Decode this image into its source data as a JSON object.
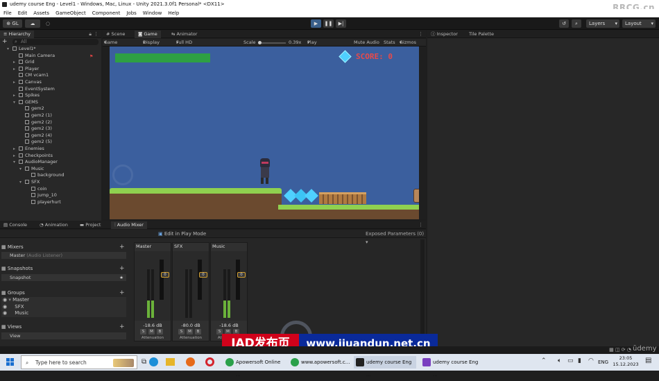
{
  "window": {
    "title": "udemy course Eng - Level1 - Windows, Mac, Linux - Unity 2021.3.0f1 Personal* <DX11>",
    "watermark_top": "RRCG.cn"
  },
  "menu": [
    "File",
    "Edit",
    "Assets",
    "GameObject",
    "Component",
    "Jobs",
    "Window",
    "Help"
  ],
  "toolbar": {
    "account": "GL",
    "layers": "Layers",
    "layout": "Layout"
  },
  "hierarchy": {
    "tab": "Hierarchy",
    "search_placeholder": "All",
    "items": [
      {
        "label": "Level1*",
        "depth": 0,
        "arrow": "▾",
        "icon": "unity-scene-icon"
      },
      {
        "label": "Main Camera",
        "depth": 1,
        "arrow": "",
        "icon": "gameobject-cube-icon"
      },
      {
        "label": "Grid",
        "depth": 1,
        "arrow": "▸",
        "icon": "gameobject-cube-icon"
      },
      {
        "label": "Player",
        "depth": 1,
        "arrow": "▸",
        "icon": "gameobject-cube-icon"
      },
      {
        "label": "CM vcam1",
        "depth": 1,
        "arrow": "",
        "icon": "gameobject-cube-icon"
      },
      {
        "label": "Canvas",
        "depth": 1,
        "arrow": "▸",
        "icon": "gameobject-cube-icon"
      },
      {
        "label": "EventSystem",
        "depth": 1,
        "arrow": "",
        "icon": "gameobject-cube-icon"
      },
      {
        "label": "Spikes",
        "depth": 1,
        "arrow": "▸",
        "icon": "gameobject-cube-icon"
      },
      {
        "label": "GEMS",
        "depth": 1,
        "arrow": "▾",
        "icon": "gameobject-cube-icon"
      },
      {
        "label": "gem2",
        "depth": 2,
        "arrow": "",
        "icon": "gameobject-cube-icon"
      },
      {
        "label": "gem2 (1)",
        "depth": 2,
        "arrow": "",
        "icon": "gameobject-cube-icon"
      },
      {
        "label": "gem2 (2)",
        "depth": 2,
        "arrow": "",
        "icon": "gameobject-cube-icon"
      },
      {
        "label": "gem2 (3)",
        "depth": 2,
        "arrow": "",
        "icon": "gameobject-cube-icon"
      },
      {
        "label": "gem2 (4)",
        "depth": 2,
        "arrow": "",
        "icon": "gameobject-cube-icon"
      },
      {
        "label": "gem2 (5)",
        "depth": 2,
        "arrow": "",
        "icon": "gameobject-cube-icon"
      },
      {
        "label": "Enemies",
        "depth": 1,
        "arrow": "▸",
        "icon": "gameobject-cube-icon"
      },
      {
        "label": "Checkpoints",
        "depth": 1,
        "arrow": "▸",
        "icon": "gameobject-cube-icon"
      },
      {
        "label": "AudioManager",
        "depth": 1,
        "arrow": "▾",
        "icon": "gameobject-cube-icon"
      },
      {
        "label": "Music",
        "depth": 2,
        "arrow": "▾",
        "icon": "gameobject-cube-icon"
      },
      {
        "label": "background",
        "depth": 3,
        "arrow": "",
        "icon": "gameobject-cube-icon"
      },
      {
        "label": "SFX",
        "depth": 2,
        "arrow": "▾",
        "icon": "gameobject-cube-icon"
      },
      {
        "label": "coin",
        "depth": 3,
        "arrow": "",
        "icon": "gameobject-cube-icon"
      },
      {
        "label": "jump_10",
        "depth": 3,
        "arrow": "",
        "icon": "gameobject-cube-icon"
      },
      {
        "label": "playerhurt",
        "depth": 3,
        "arrow": "",
        "icon": "gameobject-cube-icon"
      }
    ]
  },
  "center_tabs": [
    "Scene",
    "Game",
    "Animator"
  ],
  "game_bar": {
    "mode": "Game",
    "display": "Display 1",
    "resolution": "Full HD (1920x1080)",
    "scale_label": "Scale",
    "scale_value": "0.39x",
    "play_focused": "Play Focused",
    "mute_audio": "Mute Audio",
    "stats": "Stats",
    "gizmos": "Gizmos"
  },
  "game": {
    "score_text": "SCORE: 0",
    "health_fraction": 1.0
  },
  "right_tabs": [
    "Inspector",
    "Tile Palette"
  ],
  "bottom_tabs": [
    "Console",
    "Animation",
    "Project",
    "Audio Mixer"
  ],
  "mixer": {
    "edit_in_play_mode": "Edit in Play Mode",
    "exposed_parameters": "Exposed Parameters (0)",
    "mixers_head": "Mixers",
    "mixers_row": "Master",
    "mixers_row_dim": "(Audio Listener)",
    "snapshots_head": "Snapshots",
    "snapshots_row": "Snapshot",
    "groups_head": "Groups",
    "groups": [
      "Master",
      "SFX",
      "Music"
    ],
    "views_head": "Views",
    "views_row": "View",
    "strips": [
      {
        "name": "Master",
        "db": "-18.6 dB",
        "level": 0.35
      },
      {
        "name": "SFX",
        "db": "-80.0 dB",
        "level": 0.0
      },
      {
        "name": "Music",
        "db": "-18.6 dB",
        "level": 0.35
      }
    ],
    "strip_level_label": "0",
    "strip_buttons": [
      "S",
      "M",
      "B"
    ],
    "strip_footer": "Attenuation"
  },
  "overlay": {
    "jad_label": "JAD发布页",
    "url": "www.jiuandun.net.cn"
  },
  "taskbar": {
    "search_placeholder": "Type here to search",
    "apps": [
      "Apowersoft Online ...",
      "www.apowersoft.c...",
      "udemy course Eng ...",
      "udemy course Eng ..."
    ],
    "language": "ENG",
    "time": "23:05",
    "date": "15.12.2023",
    "brand": "ūdemy"
  },
  "colors": {
    "game_bg": "#3b5f9e",
    "grass": "#8fd14f",
    "dirt": "#6b4a2f",
    "gem": "#4fd0ff",
    "score": "#e84a4a",
    "health": "#2ea043",
    "jad_red": "#d0021b"
  }
}
